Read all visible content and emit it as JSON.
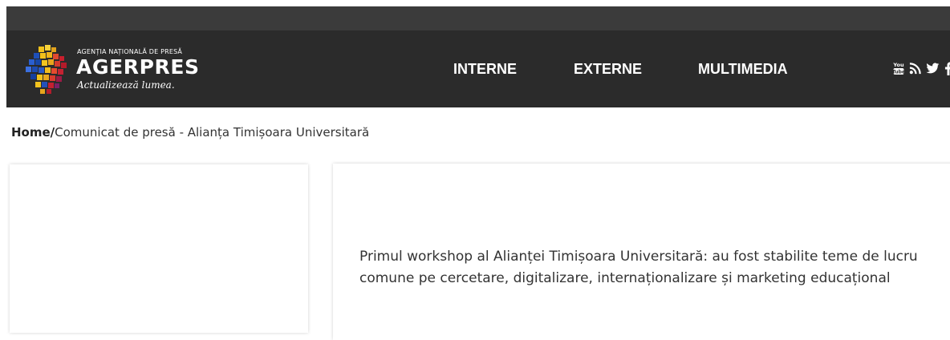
{
  "header": {
    "logo": {
      "agency_line": "AGENȚIA NAȚIONALĂ DE PRESĂ",
      "name": "AGERPRES",
      "tagline": "Actualizează lumea."
    },
    "nav": [
      {
        "label": "INTERNE"
      },
      {
        "label": "EXTERNE"
      },
      {
        "label": "MULTIMEDIA"
      }
    ],
    "social_icons": [
      "youtube-icon",
      "rss-icon",
      "twitter-icon",
      "facebook-icon"
    ],
    "colors": {
      "topbar": "#3b3b3b",
      "navbar": "#2b2b2b"
    }
  },
  "breadcrumb": {
    "home": "Home",
    "separator": "/",
    "current": "Comunicat de presă - Alianța Timișoara Universitară"
  },
  "article": {
    "title": "Primul workshop al Alianței Timișoara Universitară: au fost stabilite teme de lucru comune pe cercetare, digitalizare, internaționalizare și marketing educațional"
  }
}
